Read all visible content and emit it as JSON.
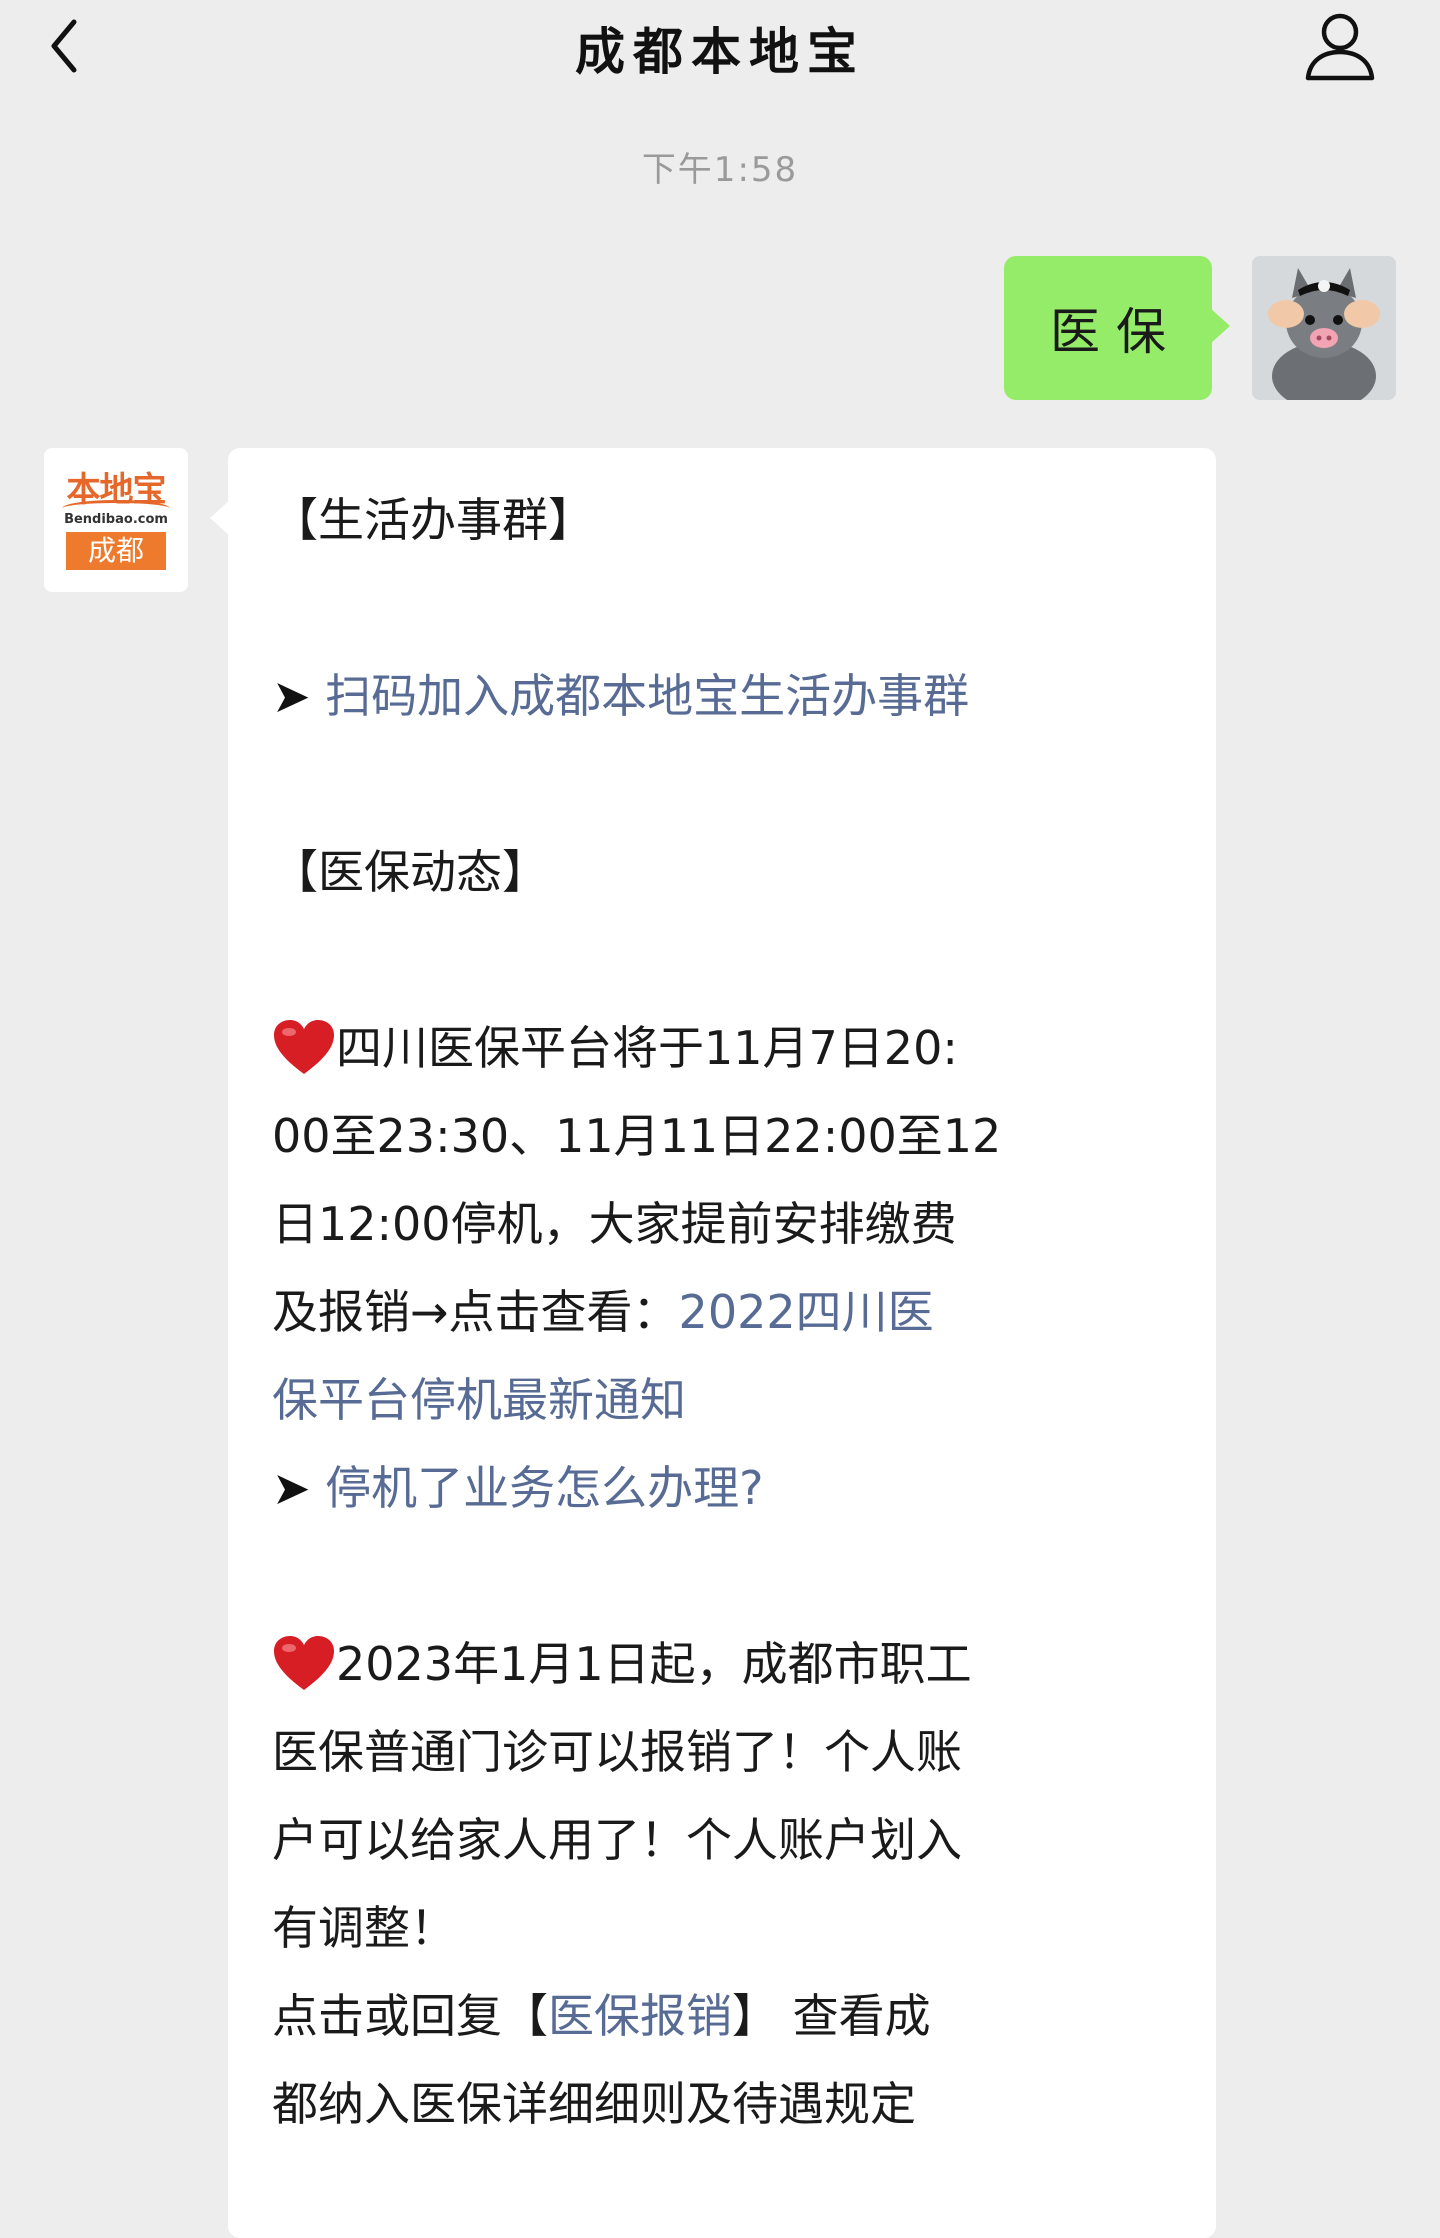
{
  "header": {
    "title": "成都本地宝"
  },
  "timestamp": "下午1:58",
  "messages": {
    "user_message": "医保",
    "bot": {
      "logo_top": "本地宝",
      "logo_domain": "Bendibao.com",
      "logo_city": "成都",
      "section1_title": "【生活办事群】",
      "arrow": "➤",
      "link_join_group": "扫码加入成都本地宝生活办事群",
      "section2_title": "【医保动态】",
      "item1_lines": [
        "四川医保平台将于11月7日20:",
        "00至23:30、11月11日22:00至12",
        "日12:00停机，大家提前安排缴费",
        "及报销→点击查看："
      ],
      "item1_link_part1": "2022四川医",
      "item1_link_part2": "保平台停机最新通知",
      "link_how_handle": "停机了业务怎么办理?",
      "item2_lines": [
        "2023年1月1日起，成都市职工",
        "医保普通门诊可以报销了！个人账",
        "户可以给家人用了！个人账户划入",
        "有调整！"
      ],
      "item2_reply_prefix": "点击或回复【",
      "item2_reply_link": "医保报销",
      "item2_reply_suffix": "】 查看成",
      "item2_last_line": "都纳入医保详细细则及待遇规定"
    }
  },
  "colors": {
    "background": "#ededed",
    "user_bubble": "#95ec69",
    "bot_bubble": "#ffffff",
    "link": "#576b95",
    "heart": "#d81e25",
    "logo_orange": "#ee7a2e"
  },
  "icons": {
    "back": "chevron-left-icon",
    "profile": "user-outline-icon",
    "heart": "heart-icon"
  }
}
